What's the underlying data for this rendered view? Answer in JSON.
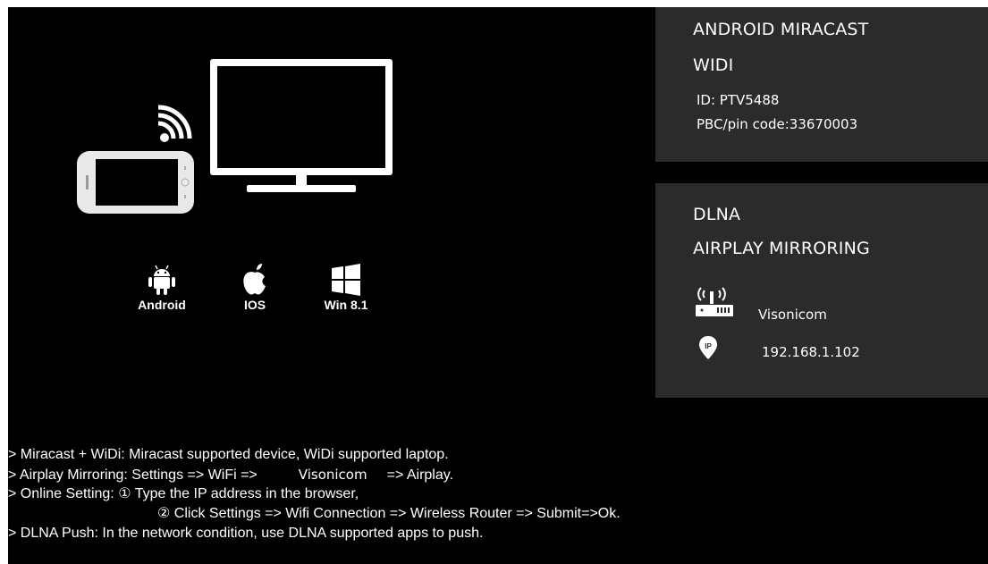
{
  "miracast_panel": {
    "title_line1": "ANDROID MIRACAST",
    "title_line2": "WIDI",
    "id_line": "ID: PTV5488",
    "pin_line": "PBC/pin code:33670003"
  },
  "dlna_panel": {
    "title_line1": "DLNA",
    "title_line2": "AIRPLAY MIRRORING",
    "router_icon": "wifi-router-icon",
    "router_name": "Visonicom",
    "ip_icon": "ip-pin-icon",
    "ip_address": "192.168.1.102"
  },
  "illustration": {
    "icons": [
      "smartphone-icon",
      "wifi-signal-icon",
      "tv-monitor-icon"
    ]
  },
  "platforms": [
    {
      "icon": "android-icon",
      "label": "Android"
    },
    {
      "icon": "apple-icon",
      "label": "IOS"
    },
    {
      "icon": "windows-icon",
      "label": "Win 8.1"
    }
  ],
  "instructions": {
    "line1": "> Miracast + WiDi: Miracast supported device, WiDi supported laptop.",
    "line2_prefix": "> Airplay Mirroring: Settings => WiFi =>",
    "line2_ssid": "Visonicom",
    "line2_suffix": "=> Airplay.",
    "line3": "> Online Setting: ① Type the IP address in the browser,",
    "line4": "② Click Settings => Wifi Connection => Wireless Router => Submit=>Ok.",
    "line5": "> DLNA Push: In the network condition, use DLNA supported apps to push."
  },
  "colors": {
    "background": "#000000",
    "panel": "#2b2b2b",
    "text": "#ffffff"
  }
}
